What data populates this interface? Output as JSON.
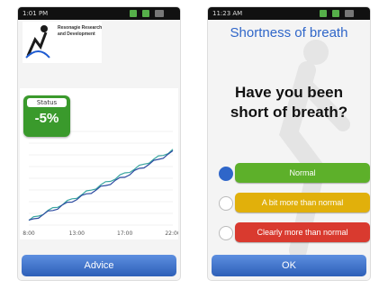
{
  "screen1": {
    "status_time": "1:01 PM",
    "logo_text": "Resonagie Research and Development",
    "status_label": "Status",
    "status_value": "-5%",
    "x_ticks": [
      "8:00",
      "13:00",
      "17:00",
      "22:00"
    ],
    "advice_button": "Advice",
    "colors": {
      "card": "#3a9a2c",
      "button": "#2d5fb8",
      "line_primary": "#3aa6a0",
      "line_secondary": "#2c4aa0"
    }
  },
  "screen2": {
    "status_time": "11:23 AM",
    "title": "Shortness of breath",
    "question": "Have you been short of breath?",
    "options": [
      {
        "label": "Normal",
        "color": "#5db02a",
        "selected": true
      },
      {
        "label": "A bit more than normal",
        "color": "#e1b00b",
        "selected": false
      },
      {
        "label": "Clearly more than normal",
        "color": "#d93a2f",
        "selected": false
      }
    ],
    "ok_button": "OK",
    "colors": {
      "title": "#2f66c9"
    }
  },
  "chart_data": {
    "type": "line",
    "title": "",
    "x": [
      "8:00",
      "13:00",
      "17:00",
      "22:00"
    ],
    "series": [
      {
        "values": [
          0.05,
          0.3,
          0.55,
          0.8
        ]
      },
      {
        "values": [
          0.04,
          0.28,
          0.52,
          0.78
        ]
      }
    ],
    "grid": true
  }
}
